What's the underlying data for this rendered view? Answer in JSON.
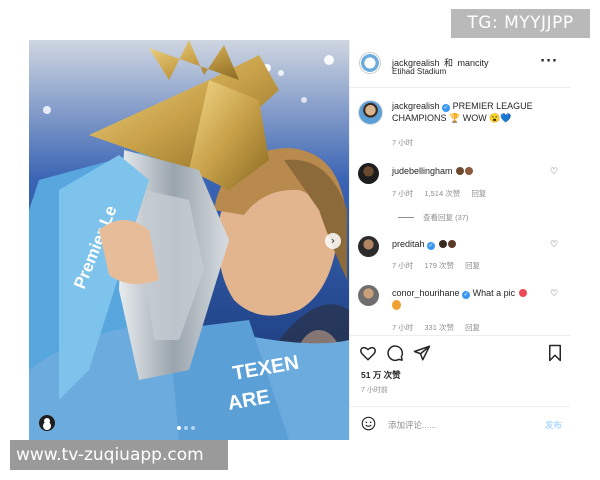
{
  "watermarks": {
    "top": "TG: MYYJJPP",
    "bottom": "www.tv-zuqiuapp.com"
  },
  "post": {
    "header": {
      "author": "jackgrealish",
      "collab_joiner": "和",
      "collaborator": "mancity",
      "location": "Etihad Stadium",
      "more_icon": "more-options-icon"
    },
    "photo": {
      "shirt_text_1": "TEXEN",
      "shirt_text_2": "ARE",
      "ribbon_text": "Premier Le",
      "colors": {
        "shirt": "#6cabdd",
        "trophy": "#c9a24a",
        "sky": "#1a3f8f"
      }
    },
    "caption": {
      "author": "jackgrealish",
      "text": "PREMIER LEAGUE CHAMPIONS 🏆 WOW 😮💙",
      "time": "7 小时"
    },
    "comments": [
      {
        "user": "judebellingham",
        "text": "",
        "time": "7 小时",
        "likes": "1,514 次赞",
        "reply": "回复"
      },
      {
        "user": "preditah",
        "text": "",
        "time": "7 小时",
        "likes": "179 次赞",
        "reply": "回复"
      },
      {
        "user": "conor_hourihane",
        "text": "What a pic",
        "time": "7 小时",
        "likes": "331 次赞",
        "reply": "回复"
      }
    ],
    "view_replies": "查看回复 (37)",
    "likes_count": "51 万 次赞",
    "posted_ago": "7 小时前",
    "add_comment_placeholder": "添加评论......",
    "post_button": "发布",
    "colors": {
      "verified": "#3897f0",
      "muted": "#8e8e8e",
      "post_disabled": "#b3dbff",
      "heart_red": "#ed4956"
    }
  }
}
